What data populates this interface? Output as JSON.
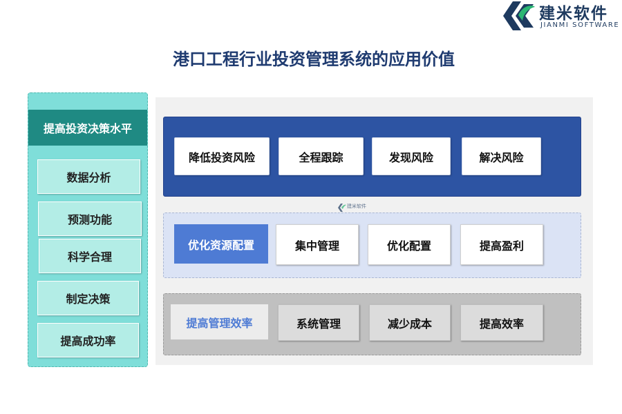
{
  "brand": {
    "name_cn": "建米软件",
    "name_en": "JIANMI SOFTWARE",
    "icon": "jianmi-logo-icon",
    "colors": {
      "dark": "#1e3a5f",
      "green": "#2bb673"
    }
  },
  "title": "港口工程行业投资管理系统的应用价值",
  "left": {
    "heading": "提高投资决策水平",
    "items": [
      "数据分析",
      "预测功能",
      "科学合理",
      "制定决策",
      "提高成功率"
    ]
  },
  "rows": [
    {
      "items": [
        "降低投资风险",
        "全程跟踪",
        "发现风险",
        "解决风险"
      ]
    },
    {
      "label": "优化资源配置",
      "items": [
        "集中管理",
        "优化配置",
        "提高盈利"
      ]
    },
    {
      "label": "提高管理效率",
      "items": [
        "系统管理",
        "减少成本",
        "提高效率"
      ]
    }
  ],
  "colors": {
    "title": "#1f3b70",
    "left_panel": "#7fded9",
    "left_heading": "#1f8a83",
    "row1_band": "#2d54a3",
    "row2_band": "#dbe3f5",
    "row2_label": "#4e7bd4",
    "row3_band": "#c0c0c0"
  }
}
